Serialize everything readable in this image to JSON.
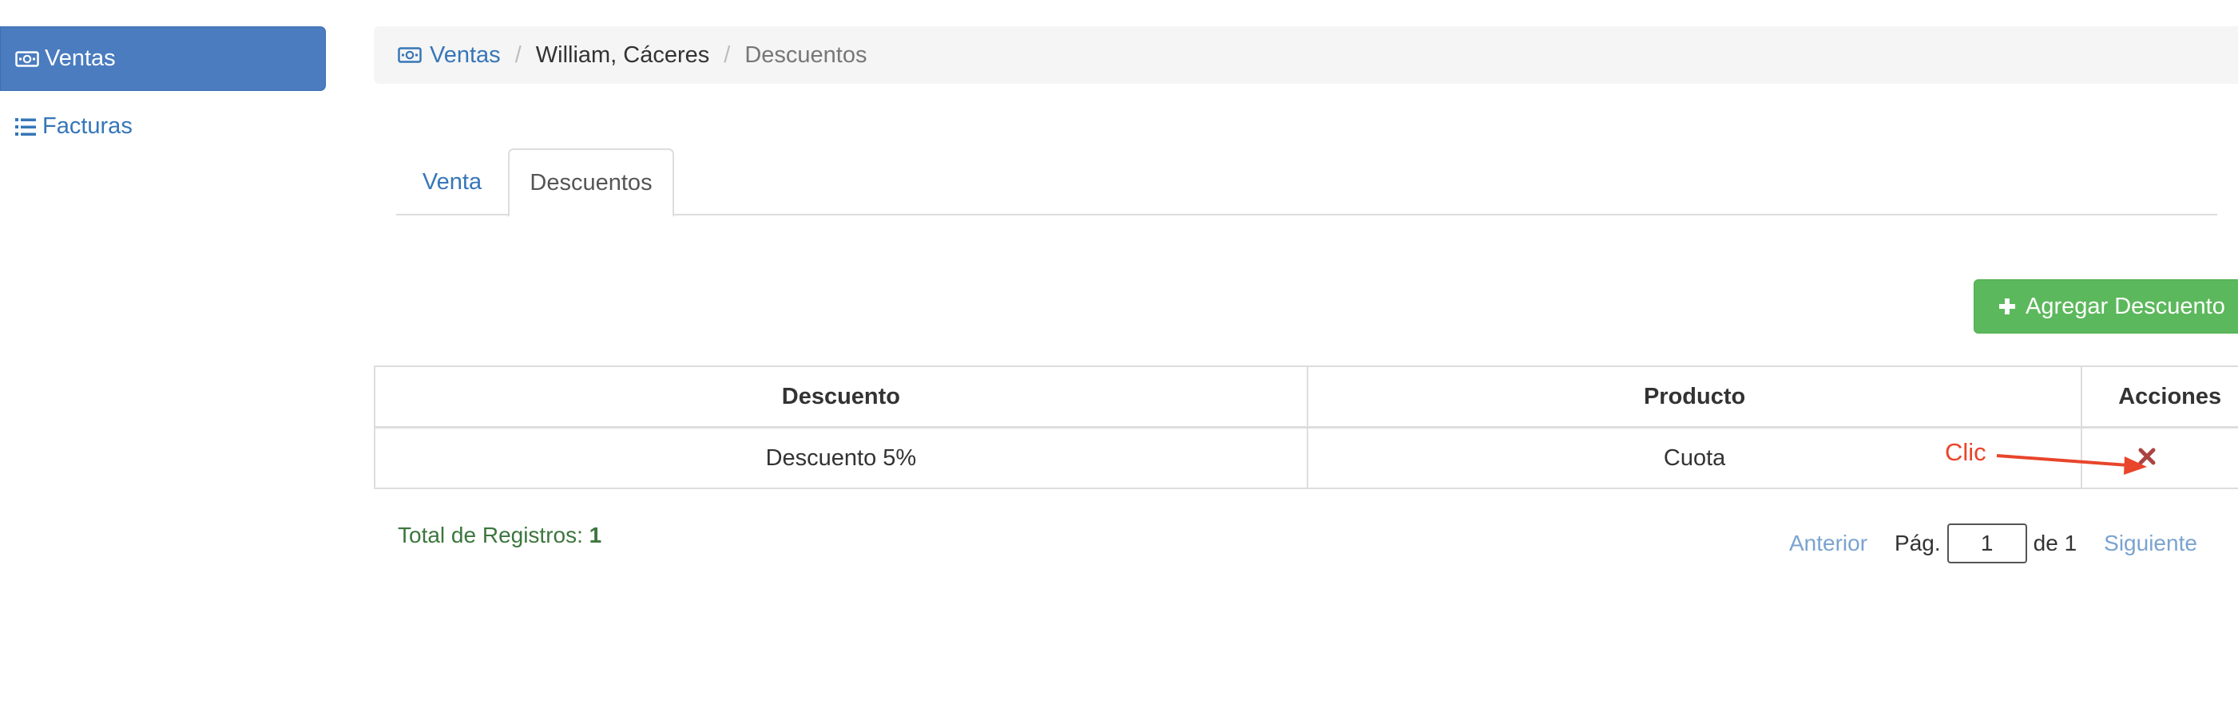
{
  "sidebar": {
    "items": [
      {
        "label": "Ventas",
        "icon": "money-icon",
        "active": true
      },
      {
        "label": "Facturas",
        "icon": "list-icon",
        "active": false
      }
    ]
  },
  "breadcrumb": {
    "items": [
      "Ventas",
      "William, Cáceres",
      "Descuentos"
    ],
    "separator": "/"
  },
  "tabs": [
    {
      "label": "Venta",
      "active": false
    },
    {
      "label": "Descuentos",
      "active": true
    }
  ],
  "toolbar": {
    "add_label": "Agregar Descuento",
    "add_icon": "plus-icon"
  },
  "table": {
    "columns": [
      "Descuento",
      "Producto",
      "Acciones"
    ],
    "rows": [
      {
        "descuento": "Descuento 5%",
        "producto": "Cuota",
        "action_icon": "delete-icon"
      }
    ]
  },
  "annotation": {
    "label": "Clic"
  },
  "footer": {
    "total_label": "Total de Registros:",
    "total_value": "1"
  },
  "pagination": {
    "prev_label": "Anterior",
    "page_label": "Pág.",
    "page_value": "1",
    "of_label": "de 1",
    "next_label": "Siguiente"
  },
  "colors": {
    "primary": "#4a7cbf",
    "link": "#3676b8",
    "success": "#5cb85c",
    "total_text": "#3c763d",
    "danger": "#a94442",
    "annotation": "#e8452a"
  }
}
